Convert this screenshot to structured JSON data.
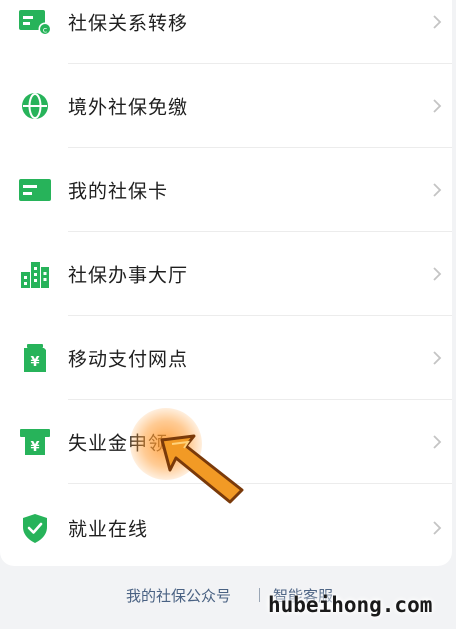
{
  "menu": {
    "items": [
      {
        "label": "社保关系转移",
        "icon": "transfer-card-icon"
      },
      {
        "label": "境外社保免缴",
        "icon": "globe-icon"
      },
      {
        "label": "我的社保卡",
        "icon": "card-icon"
      },
      {
        "label": "社保办事大厅",
        "icon": "building-icon"
      },
      {
        "label": "移动支付网点",
        "icon": "wallet-yen-icon"
      },
      {
        "label": "失业金申领",
        "icon": "atm-yen-icon"
      },
      {
        "label": "就业在线",
        "icon": "shield-check-icon"
      }
    ]
  },
  "footer": {
    "link_official": "我的社保公众号",
    "link_service": "智能客服"
  },
  "watermark": "hubeihong.com",
  "colors": {
    "accent": "#27b35a",
    "link": "#4a6283",
    "tap_highlight": "#ff9a2e"
  }
}
